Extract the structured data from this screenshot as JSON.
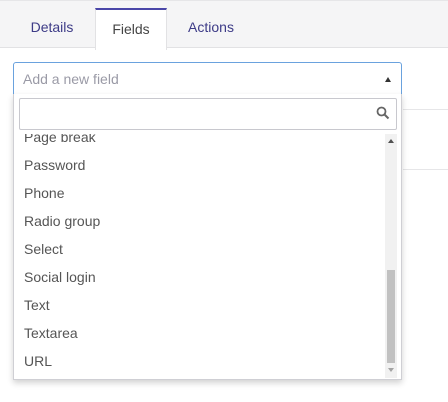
{
  "tabs": [
    {
      "label": "Details"
    },
    {
      "label": "Fields"
    },
    {
      "label": "Actions"
    }
  ],
  "field_select": {
    "placeholder": "Add a new field",
    "search_value": "",
    "options": [
      "Page break",
      "Password",
      "Phone",
      "Radio group",
      "Select",
      "Social login",
      "Text",
      "Textarea",
      "URL"
    ]
  },
  "colors": {
    "accent": "#4a46a8",
    "tab_text": "#3d3b87",
    "focus_border": "#6aa2de"
  },
  "icons": {
    "search": "search-icon",
    "dropdown_arrow": "caret-up-icon"
  }
}
